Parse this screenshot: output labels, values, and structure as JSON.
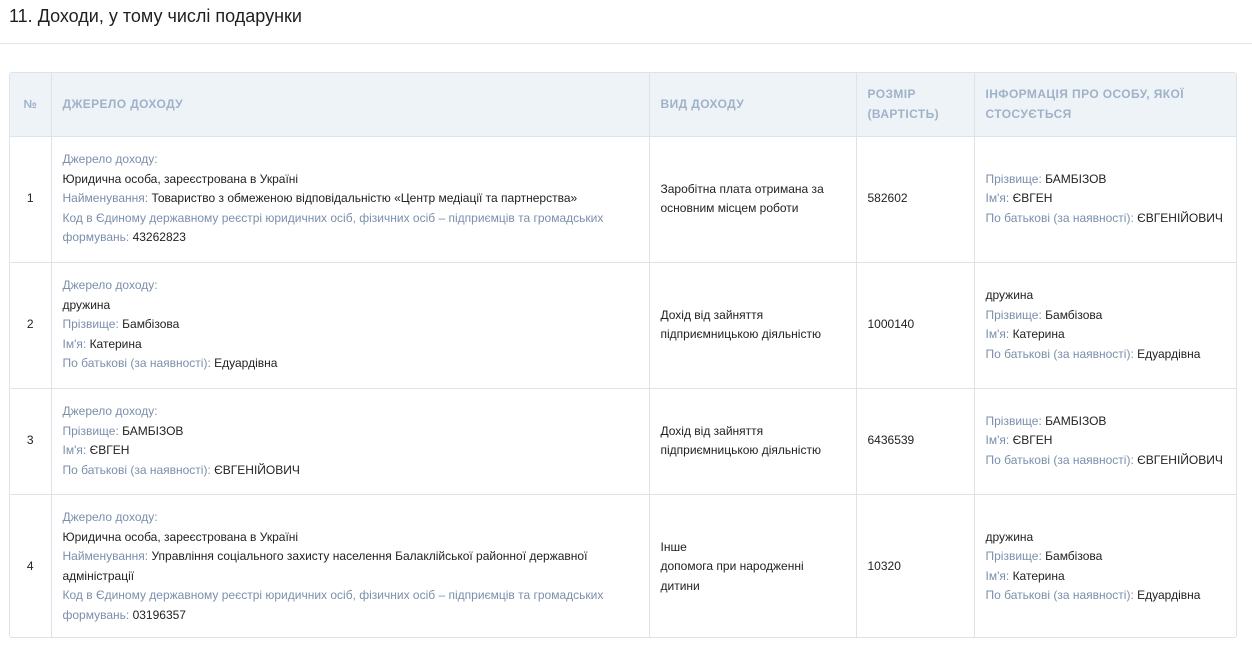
{
  "section": {
    "title": "11. Доходи, у тому числі подарунки"
  },
  "columns": {
    "num": "№",
    "source": "ДЖЕРЕЛО ДОХОДУ",
    "type": "ВИД ДОХОДУ",
    "amount": "РОЗМІР (ВАРТІСТЬ)",
    "person": "ІНФОРМАЦІЯ ПРО ОСОБУ, ЯКОЇ СТОСУЄТЬСЯ"
  },
  "labels": {
    "source": "Джерело доходу:",
    "name": "Найменування:",
    "code": "Код в Єдиному державному реєстрі юридичних осіб, фізичних осіб – підприємців та громадських формувань:",
    "surname": "Прізвище:",
    "firstname": "Ім'я:",
    "patronymic": "По батькові (за наявності):"
  },
  "rows": [
    {
      "num": "1",
      "source": {
        "kind": "Юридична особа, зареєстрована в Україні",
        "name": "Товариство з обмеженою відповідальністю «Центр медіації та партнерства»",
        "code": "43262823"
      },
      "type": [
        "Заробітна плата отримана за основним місцем роботи"
      ],
      "amount": "582602",
      "person": {
        "surname": "БАМБІЗОВ",
        "firstname": "ЄВГЕН",
        "patronymic": "ЄВГЕНІЙОВИЧ"
      }
    },
    {
      "num": "2",
      "source": {
        "relation": "дружина",
        "surname": "Бамбізова",
        "firstname": "Катерина",
        "patronymic": "Едуардівна"
      },
      "type": [
        "Дохід від зайняття підприємницькою діяльністю"
      ],
      "amount": "1000140",
      "person": {
        "relation": "дружина",
        "surname": "Бамбізова",
        "firstname": "Катерина",
        "patronymic": "Едуардівна"
      }
    },
    {
      "num": "3",
      "source": {
        "surname": "БАМБІЗОВ",
        "firstname": "ЄВГЕН",
        "patronymic": "ЄВГЕНІЙОВИЧ"
      },
      "type": [
        "Дохід від зайняття підприємницькою діяльністю"
      ],
      "amount": "6436539",
      "person": {
        "surname": "БАМБІЗОВ",
        "firstname": "ЄВГЕН",
        "patronymic": "ЄВГЕНІЙОВИЧ"
      }
    },
    {
      "num": "4",
      "source": {
        "kind": "Юридична особа, зареєстрована в Україні",
        "name": "Управління соціального захисту населення Балаклійської районної державної адміністрації",
        "code": "03196357"
      },
      "type": [
        "Інше",
        "допомога при народженні дитини"
      ],
      "amount": "10320",
      "person": {
        "relation": "дружина",
        "surname": "Бамбізова",
        "firstname": "Катерина",
        "patronymic": "Едуардівна"
      }
    }
  ]
}
